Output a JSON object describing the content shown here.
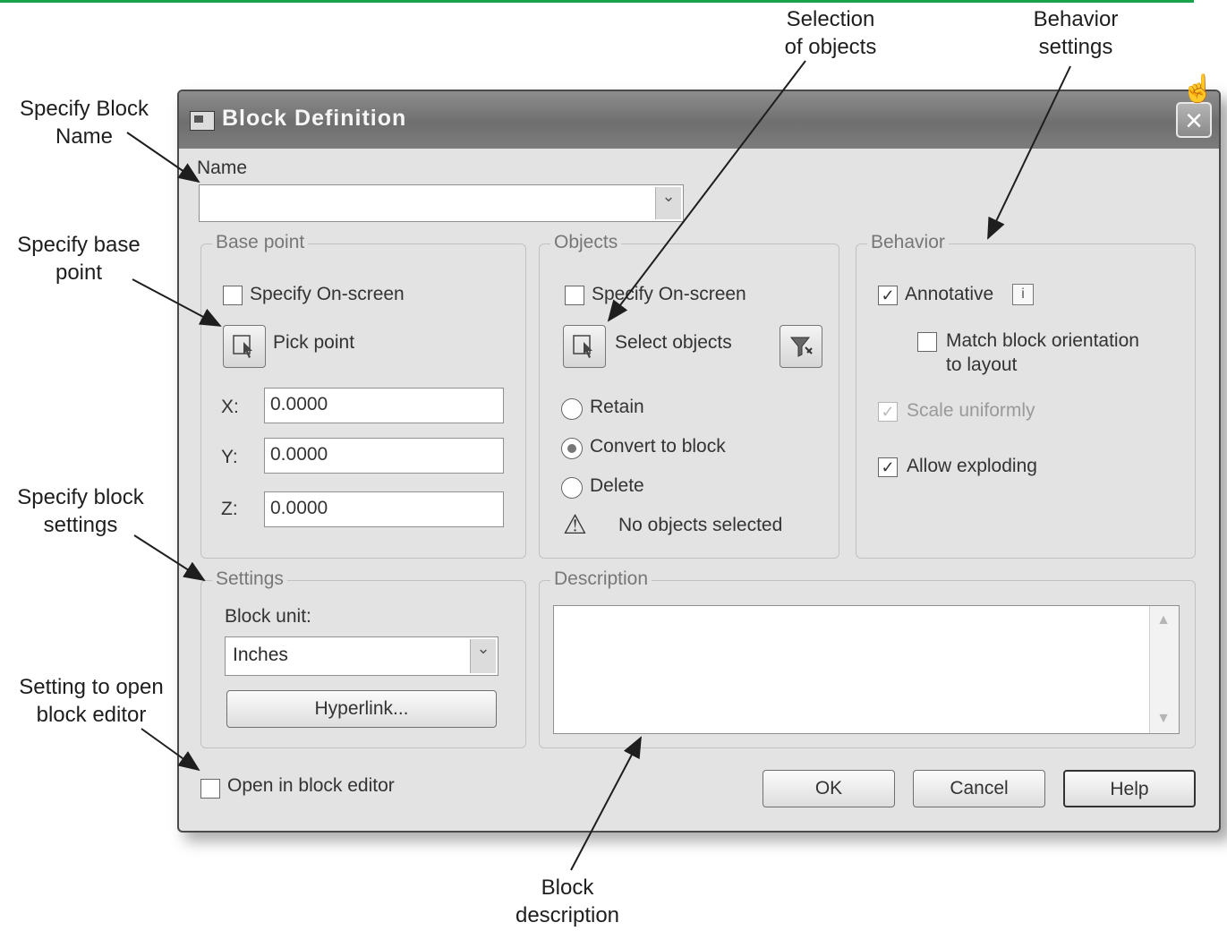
{
  "callouts": {
    "block_name": [
      "Specify Block",
      "Name"
    ],
    "base_point": [
      "Specify base",
      "point"
    ],
    "block_settings": [
      "Specify block",
      "settings"
    ],
    "open_editor": [
      "Setting to open",
      "block editor"
    ],
    "selection": [
      "Selection",
      "of objects"
    ],
    "behavior": [
      "Behavior",
      "settings"
    ],
    "description": [
      "Block",
      "description"
    ]
  },
  "dialog": {
    "title": "Block Definition",
    "close_icon": "×",
    "name_label": "Name",
    "name_value": ""
  },
  "base_point": {
    "title": "Base point",
    "specify_onscreen": "Specify On-screen",
    "specify_onscreen_checked": false,
    "pick_point": "Pick point",
    "x_label": "X:",
    "x_value": "0.0000",
    "y_label": "Y:",
    "y_value": "0.0000",
    "z_label": "Z:",
    "z_value": "0.0000"
  },
  "objects": {
    "title": "Objects",
    "specify_onscreen": "Specify On-screen",
    "specify_onscreen_checked": false,
    "select_objects": "Select objects",
    "retain": "Retain",
    "convert": "Convert to block",
    "delete": "Delete",
    "selected_option": "convert",
    "status": "No objects selected"
  },
  "behavior": {
    "title": "Behavior",
    "annotative": "Annotative",
    "annotative_checked": true,
    "match_orientation_line1": "Match block orientation",
    "match_orientation_line2": "to layout",
    "match_orientation_checked": false,
    "scale_uniformly": "Scale uniformly",
    "scale_uniformly_checked": true,
    "allow_exploding": "Allow exploding",
    "allow_exploding_checked": true
  },
  "settings": {
    "title": "Settings",
    "block_unit_label": "Block unit:",
    "block_unit_value": "Inches",
    "hyperlink": "Hyperlink..."
  },
  "description": {
    "title": "Description",
    "value": ""
  },
  "footer": {
    "open_in_editor": "Open in block editor",
    "open_in_editor_checked": false,
    "ok": "OK",
    "cancel": "Cancel",
    "help": "Help"
  },
  "icons": {
    "check": "✓",
    "dropdown": "⌄",
    "warning": "⚠",
    "info": "i",
    "scroll_up": "▲",
    "scroll_down": "▼",
    "hand": "☝"
  }
}
